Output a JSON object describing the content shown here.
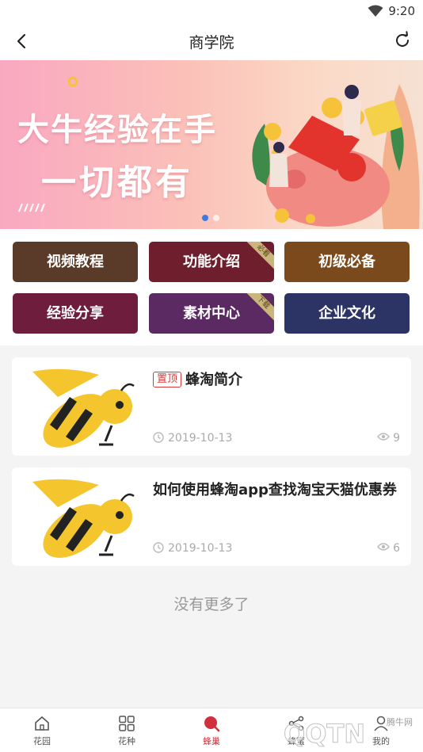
{
  "status_bar": {
    "time": "9:20"
  },
  "nav": {
    "title": "商学院"
  },
  "banner": {
    "line1": "大牛经验在手",
    "line2": "一切都有",
    "page_index": 1,
    "page_count": 2
  },
  "grid": {
    "items": [
      {
        "label": "视频教程",
        "color": "#5a3a28",
        "tag": ""
      },
      {
        "label": "功能介绍",
        "color": "#6e1e2c",
        "tag": "必看"
      },
      {
        "label": "初级必备",
        "color": "#7a4a1c",
        "tag": ""
      },
      {
        "label": "经验分享",
        "color": "#6e1e3c",
        "tag": ""
      },
      {
        "label": "素材中心",
        "color": "#5b2a63",
        "tag": "下载"
      },
      {
        "label": "企业文化",
        "color": "#2c3466",
        "tag": ""
      }
    ]
  },
  "articles": [
    {
      "pin": "置顶",
      "title": "蜂淘简介",
      "date": "2019-10-13",
      "views": "9"
    },
    {
      "pin": "",
      "title": "如何使用蜂淘app查找淘宝天猫优惠券",
      "date": "2019-10-13",
      "views": "6"
    }
  ],
  "footer_text": "没有更多了",
  "tabbar": {
    "items": [
      {
        "label": "花园",
        "icon": "home-icon"
      },
      {
        "label": "花种",
        "icon": "grid-icon"
      },
      {
        "label": "蜂巢",
        "icon": "hive-icon"
      },
      {
        "label": "蜂蜜",
        "icon": "share-icon"
      },
      {
        "label": "我的",
        "icon": "user-icon"
      }
    ],
    "active_index": 2,
    "active_color": "#d0313c"
  },
  "watermark": {
    "text": "QQTN",
    "sub": "腾牛网"
  }
}
